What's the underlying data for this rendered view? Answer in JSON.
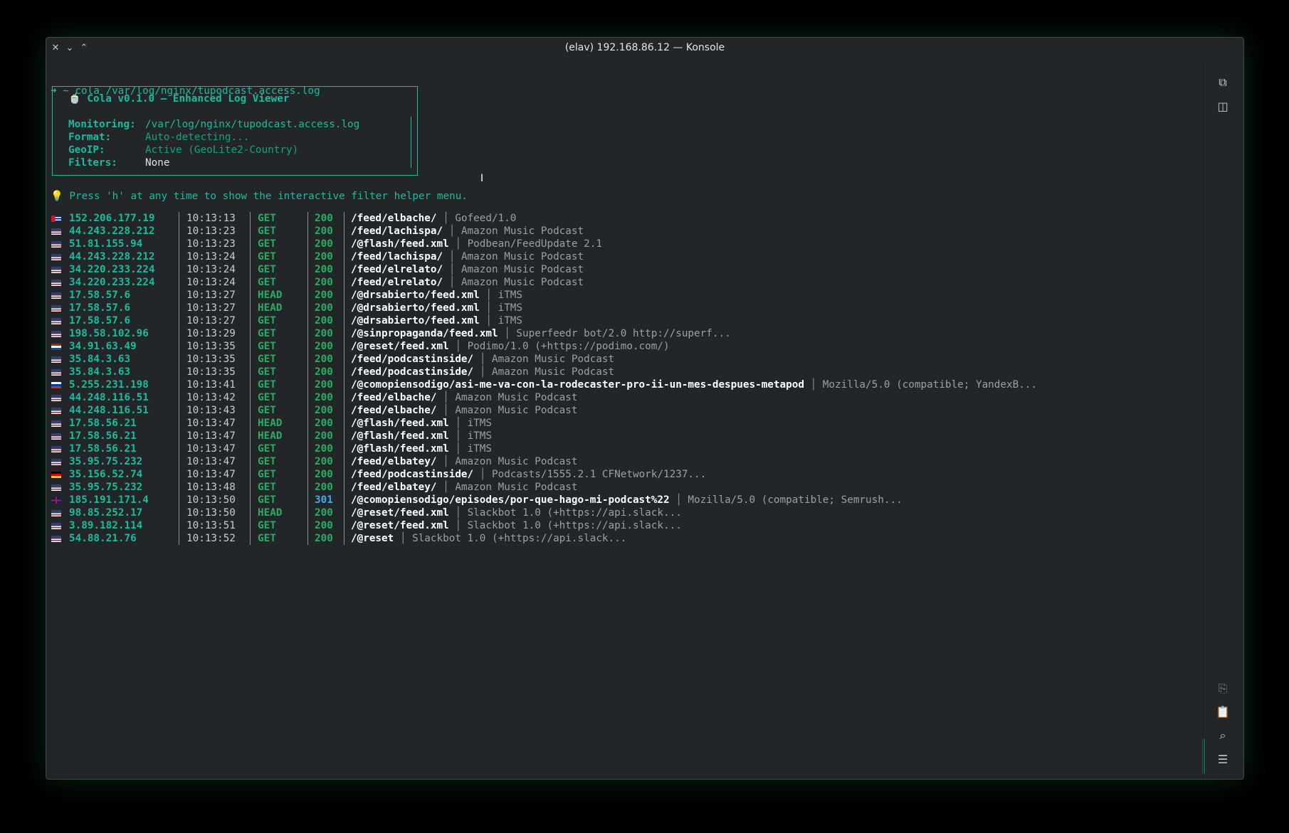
{
  "window": {
    "title": "(elav) 192.168.86.12 — Konsole",
    "close_glyph": "✕",
    "minimize_glyph": "⌄",
    "maximize_glyph": "⌃"
  },
  "prompt": {
    "arrow": "➜",
    "command": " ~ cola /var/log/nginx/tupodcast.access.log"
  },
  "banner": {
    "title": "🍵 Cola v0.1.0 — Enhanced Log Viewer",
    "monitoring_label": "Monitoring:",
    "monitoring_value": "/var/log/nginx/tupodcast.access.log",
    "format_label": "Format:",
    "format_value": "Auto-detecting...",
    "geoip_label": "GeoIP:",
    "geoip_value": "Active (GeoLite2-Country)",
    "filters_label": "Filters:",
    "filters_value": "None"
  },
  "hint": {
    "icon": "💡",
    "text": " Press 'h' at any time to show the interactive filter helper menu."
  },
  "log_rows": [
    {
      "flag": "cu",
      "ip": "152.206.177.19",
      "time": "10:13:13",
      "method": "GET",
      "status": "200",
      "path": "/feed/elbache/",
      "ua": "Gofeed/1.0"
    },
    {
      "flag": "us",
      "ip": "44.243.228.212",
      "time": "10:13:23",
      "method": "GET",
      "status": "200",
      "path": "/feed/lachispa/",
      "ua": "Amazon Music Podcast"
    },
    {
      "flag": "us",
      "ip": "51.81.155.94",
      "time": "10:13:23",
      "method": "GET",
      "status": "200",
      "path": "/@flash/feed.xml",
      "ua": "Podbean/FeedUpdate 2.1"
    },
    {
      "flag": "us",
      "ip": "44.243.228.212",
      "time": "10:13:24",
      "method": "GET",
      "status": "200",
      "path": "/feed/lachispa/",
      "ua": "Amazon Music Podcast"
    },
    {
      "flag": "us",
      "ip": "34.220.233.224",
      "time": "10:13:24",
      "method": "GET",
      "status": "200",
      "path": "/feed/elrelato/",
      "ua": "Amazon Music Podcast"
    },
    {
      "flag": "us",
      "ip": "34.220.233.224",
      "time": "10:13:24",
      "method": "GET",
      "status": "200",
      "path": "/feed/elrelato/",
      "ua": "Amazon Music Podcast"
    },
    {
      "flag": "us",
      "ip": "17.58.57.6",
      "time": "10:13:27",
      "method": "HEAD",
      "status": "200",
      "path": "/@drsabierto/feed.xml",
      "ua": "iTMS"
    },
    {
      "flag": "us",
      "ip": "17.58.57.6",
      "time": "10:13:27",
      "method": "HEAD",
      "status": "200",
      "path": "/@drsabierto/feed.xml",
      "ua": "iTMS"
    },
    {
      "flag": "us",
      "ip": "17.58.57.6",
      "time": "10:13:27",
      "method": "GET",
      "status": "200",
      "path": "/@drsabierto/feed.xml",
      "ua": "iTMS"
    },
    {
      "flag": "us",
      "ip": "198.58.102.96",
      "time": "10:13:29",
      "method": "GET",
      "status": "200",
      "path": "/@sinpropaganda/feed.xml",
      "ua": "Superfeedr bot/2.0 http://superf..."
    },
    {
      "flag": "nl",
      "ip": "34.91.63.49",
      "time": "10:13:35",
      "method": "GET",
      "status": "200",
      "path": "/@reset/feed.xml",
      "ua": "Podimo/1.0 (+https://podimo.com/)"
    },
    {
      "flag": "us",
      "ip": "35.84.3.63",
      "time": "10:13:35",
      "method": "GET",
      "status": "200",
      "path": "/feed/podcastinside/",
      "ua": "Amazon Music Podcast"
    },
    {
      "flag": "us",
      "ip": "35.84.3.63",
      "time": "10:13:35",
      "method": "GET",
      "status": "200",
      "path": "/feed/podcastinside/",
      "ua": "Amazon Music Podcast"
    },
    {
      "flag": "ru",
      "ip": "5.255.231.198",
      "time": "10:13:41",
      "method": "GET",
      "status": "200",
      "path": "/@comopiensodigo/asi-me-va-con-la-rodecaster-pro-ii-un-mes-despues-metapod",
      "ua": "Mozilla/5.0 (compatible; YandexB..."
    },
    {
      "flag": "us",
      "ip": "44.248.116.51",
      "time": "10:13:42",
      "method": "GET",
      "status": "200",
      "path": "/feed/elbache/",
      "ua": "Amazon Music Podcast"
    },
    {
      "flag": "us",
      "ip": "44.248.116.51",
      "time": "10:13:43",
      "method": "GET",
      "status": "200",
      "path": "/feed/elbache/",
      "ua": "Amazon Music Podcast"
    },
    {
      "flag": "us",
      "ip": "17.58.56.21",
      "time": "10:13:47",
      "method": "HEAD",
      "status": "200",
      "path": "/@flash/feed.xml",
      "ua": "iTMS"
    },
    {
      "flag": "us",
      "ip": "17.58.56.21",
      "time": "10:13:47",
      "method": "HEAD",
      "status": "200",
      "path": "/@flash/feed.xml",
      "ua": "iTMS"
    },
    {
      "flag": "us",
      "ip": "17.58.56.21",
      "time": "10:13:47",
      "method": "GET",
      "status": "200",
      "path": "/@flash/feed.xml",
      "ua": "iTMS"
    },
    {
      "flag": "us",
      "ip": "35.95.75.232",
      "time": "10:13:47",
      "method": "GET",
      "status": "200",
      "path": "/feed/elbatey/",
      "ua": "Amazon Music Podcast"
    },
    {
      "flag": "de",
      "ip": "35.156.52.74",
      "time": "10:13:47",
      "method": "GET",
      "status": "200",
      "path": "/feed/podcastinside/",
      "ua": "Podcasts/1555.2.1 CFNetwork/1237..."
    },
    {
      "flag": "us",
      "ip": "35.95.75.232",
      "time": "10:13:48",
      "method": "GET",
      "status": "200",
      "path": "/feed/elbatey/",
      "ua": "Amazon Music Podcast"
    },
    {
      "flag": "gb",
      "ip": "185.191.171.4",
      "time": "10:13:50",
      "method": "GET",
      "status": "301",
      "path": "/@comopiensodigo/episodes/por-que-hago-mi-podcast%22",
      "ua": "Mozilla/5.0 (compatible; Semrush..."
    },
    {
      "flag": "us",
      "ip": "98.85.252.17",
      "time": "10:13:50",
      "method": "HEAD",
      "status": "200",
      "path": "/@reset/feed.xml",
      "ua": "Slackbot 1.0 (+https://api.slack..."
    },
    {
      "flag": "us",
      "ip": "3.89.182.114",
      "time": "10:13:51",
      "method": "GET",
      "status": "200",
      "path": "/@reset/feed.xml",
      "ua": "Slackbot 1.0 (+https://api.slack..."
    },
    {
      "flag": "us",
      "ip": "54.88.21.76",
      "time": "10:13:52",
      "method": "GET",
      "status": "200",
      "path": "/@reset",
      "ua": "Slackbot 1.0 (+https://api.slack..."
    }
  ],
  "colors": {
    "accent": "#1abc9c",
    "ok_status": "#27ae60",
    "redirect_status": "#3daee9",
    "background": "#232629"
  },
  "sidebar_icons": [
    "new-tab-icon",
    "split-view-icon",
    "copy-icon",
    "paste-icon",
    "search-icon",
    "menu-icon"
  ]
}
